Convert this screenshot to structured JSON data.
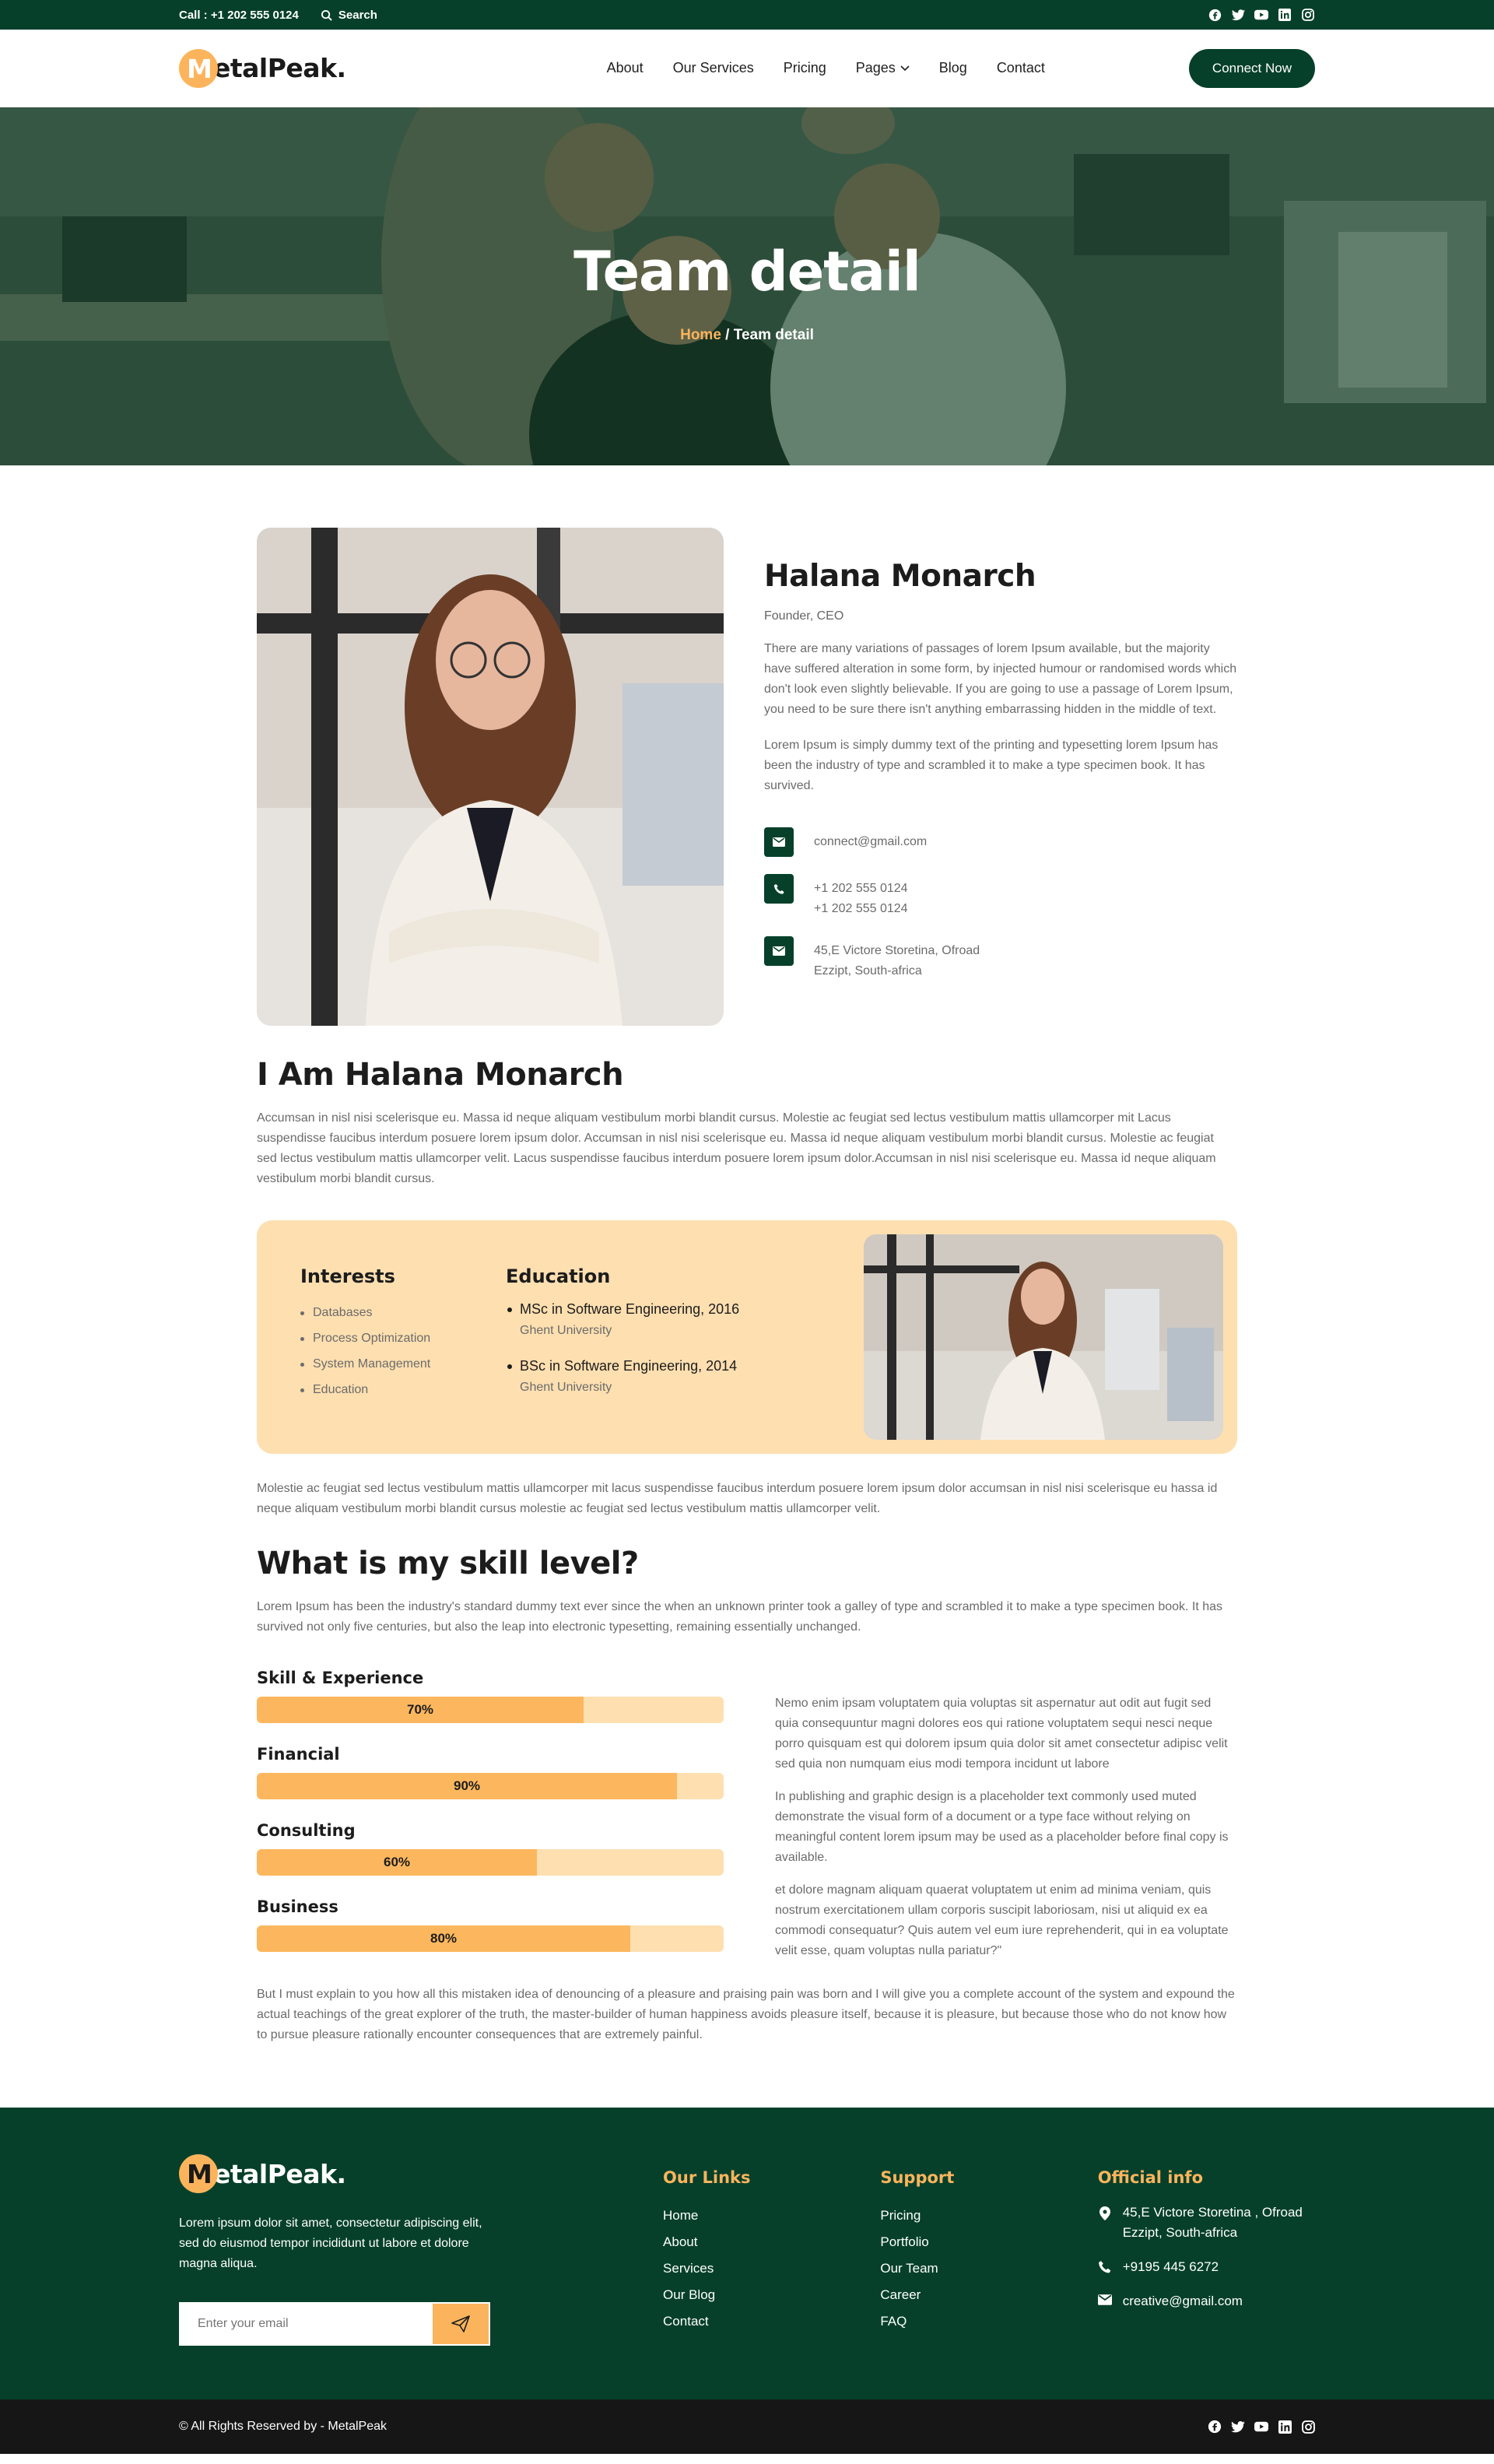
{
  "topbar": {
    "call": "Call : +1 202 555 0124",
    "search": "Search",
    "social": [
      "facebook-icon",
      "twitter-icon",
      "youtube-icon",
      "linkedin-icon",
      "instagram-icon"
    ]
  },
  "brand": {
    "letter": "M",
    "rest": "etalPeak.",
    "accent": "#fcb45c",
    "primary": "#06402b"
  },
  "nav": {
    "items": [
      "About",
      "Our Services",
      "Pricing",
      "Pages",
      "Blog",
      "Contact"
    ],
    "cta": "Connect Now"
  },
  "hero": {
    "title": "Team detail",
    "crumb_home": "Home",
    "crumb_sep": " / ",
    "crumb_current": "Team detail"
  },
  "profile": {
    "name": "Halana Monarch",
    "role": "Founder, CEO",
    "para1": "There are many variations of passages of lorem Ipsum available, but the majority have suffered alteration in some form, by injected humour or randomised words which don't look even slightly believable. If you are going to use a passage of Lorem Ipsum, you need to be sure there isn't anything embarrassing hidden in the middle of text.",
    "para2": "Lorem Ipsum is simply dummy text of the printing and typesetting lorem Ipsum has been the industry of type and scrambled it to make a type specimen book. It has survived.",
    "email": "connect@gmail.com",
    "phone1": "+1 202 555 0124",
    "phone2": "+1 202 555 0124",
    "address1": "45,E Victore Storetina, Ofroad",
    "address2": "Ezzipt, South-africa"
  },
  "about": {
    "title": "I Am Halana Monarch",
    "text": "Accumsan in nisl nisi scelerisque eu. Massa id neque aliquam vestibulum morbi blandit cursus. Molestie ac feugiat sed lectus vestibulum mattis ullamcorper mit Lacus suspendisse faucibus interdum posuere lorem ipsum dolor. Accumsan in nisl nisi scelerisque eu. Massa id neque aliquam vestibulum morbi blandit cursus. Molestie ac feugiat sed lectus vestibulum mattis ullamcorper velit. Lacus suspendisse faucibus interdum posuere lorem ipsum dolor.Accumsan in nisl nisi scelerisque eu. Massa id neque aliquam vestibulum morbi blandit cursus."
  },
  "interests": {
    "title": "Interests",
    "items": [
      "Databases",
      "Process Optimization",
      "System Management",
      "Education"
    ]
  },
  "education": {
    "title": "Education",
    "items": [
      {
        "degree": "MSc in Software Engineering, 2016",
        "school": "Ghent University"
      },
      {
        "degree": "BSc in Software Engineering, 2014",
        "school": "Ghent University"
      }
    ]
  },
  "after_box": "Molestie ac feugiat sed lectus vestibulum mattis ullamcorper mit lacus suspendisse faucibus interdum posuere lorem ipsum dolor accumsan in nisl nisi scelerisque eu hassa id neque aliquam vestibulum morbi blandit cursus molestie ac feugiat sed lectus vestibulum mattis ullamcorper velit.",
  "skills": {
    "title": "What is my skill level?",
    "intro": "Lorem Ipsum has been the industry's standard dummy text ever since the when an unknown printer took a galley of type and scrambled it to make a type specimen book. It has survived not only five centuries, but also the leap into electronic typesetting, remaining essentially unchanged.",
    "bars": [
      {
        "label": "Skill & Experience",
        "value": 70,
        "text": "70%"
      },
      {
        "label": "Financial",
        "value": 90,
        "text": "90%"
      },
      {
        "label": "Consulting",
        "value": 60,
        "text": "60%"
      },
      {
        "label": "Business",
        "value": 80,
        "text": "80%"
      }
    ],
    "side1": "Nemo enim ipsam voluptatem quia voluptas sit aspernatur aut odit aut fugit sed quia consequuntur magni dolores eos qui ratione voluptatem sequi nesci neque porro quisquam est qui dolorem ipsum quia dolor sit amet consectetur adipisc velit sed quia non numquam eius modi tempora incidunt ut labore",
    "side2": "In publishing and graphic design is a placeholder text commonly used muted demonstrate the visual form of a document or a type face without relying on meaningful content lorem ipsum may be used as a placeholder before final copy is available.",
    "side3": "et dolore magnam aliquam quaerat voluptatem ut enim ad minima veniam, quis nostrum exercitationem ullam corporis suscipit laboriosam, nisi ut aliquid ex ea commodi consequatur? Quis autem vel eum iure reprehenderit, qui in ea voluptate velit esse, quam voluptas nulla pariatur?\"",
    "closing": "But I must explain to you how all this mistaken idea of denouncing of a pleasure and praising pain was born and I will give you a complete account of the system and expound the actual teachings of the great explorer of the truth, the master-builder of human happiness avoids pleasure itself, because it is pleasure, but because those who do not know how to pursue pleasure rationally encounter consequences that are extremely painful."
  },
  "footer": {
    "about": "Lorem ipsum dolor sit amet, consectetur adipiscing elit, sed do eiusmod tempor incididunt ut labore et dolore magna aliqua.",
    "email_placeholder": "Enter your email",
    "links_title": "Our Links",
    "links": [
      "Home",
      "About",
      "Services",
      "Our Blog",
      "Contact"
    ],
    "support_title": "Support",
    "support": [
      "Pricing",
      "Portfolio",
      "Our Team",
      "Career",
      "FAQ"
    ],
    "office_title": "Official info",
    "office_address": "45,E Victore Storetina , Ofroad Ezzipt, South-africa",
    "office_phone": "+9195 445 6272",
    "office_email": "creative@gmail.com",
    "copyright": "© All Rights Reserved by - MetalPeak"
  }
}
